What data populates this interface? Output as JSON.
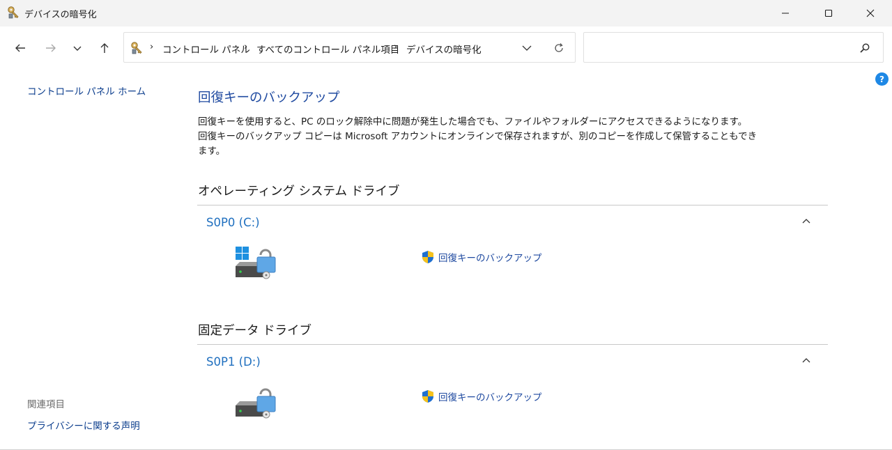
{
  "window": {
    "title": "デバイスの暗号化",
    "app_icon": "bitlocker-key-icon",
    "minimize_icon": "minimize-icon",
    "maximize_icon": "maximize-icon",
    "close_icon": "close-icon"
  },
  "navigation": {
    "back_icon": "arrow-left-icon",
    "forward_icon": "arrow-right-icon",
    "recent_icon": "chevron-down-icon",
    "up_icon": "arrow-up-icon",
    "breadcrumb": [
      "コントロール パネル",
      "すべてのコントロール パネル項目",
      "デバイスの暗号化"
    ],
    "separator": "›",
    "search_placeholder": ""
  },
  "sidebar": {
    "home_link": "コントロール パネル ホーム",
    "related_heading": "関連項目",
    "privacy_link": "プライバシーに関する声明"
  },
  "main": {
    "title": "回復キーのバックアップ",
    "description_lines": [
      "回復キーを使用すると、PC のロック解除中に問題が発生した場合でも、ファイルやフォルダーにアクセスできるようになります。",
      "回復キーのバックアップ コピーは Microsoft アカウントにオンラインで保存されますが、別のコピーを作成して保管することもでき",
      "ます。"
    ],
    "sections": [
      {
        "heading": "オペレーティング システム ドライブ",
        "drive": "S0P0 (C:)",
        "action": "回復キーのバックアップ"
      },
      {
        "heading": "固定データ ドライブ",
        "drive": "S0P1 (D:)",
        "action": "回復キーのバックアップ"
      }
    ]
  },
  "help": {
    "label": "?"
  },
  "colors": {
    "link": "#1f4aa0",
    "drive_name": "#1f6fbf",
    "titlebar": "#f3f3f3",
    "divider": "#c8c8c8"
  }
}
